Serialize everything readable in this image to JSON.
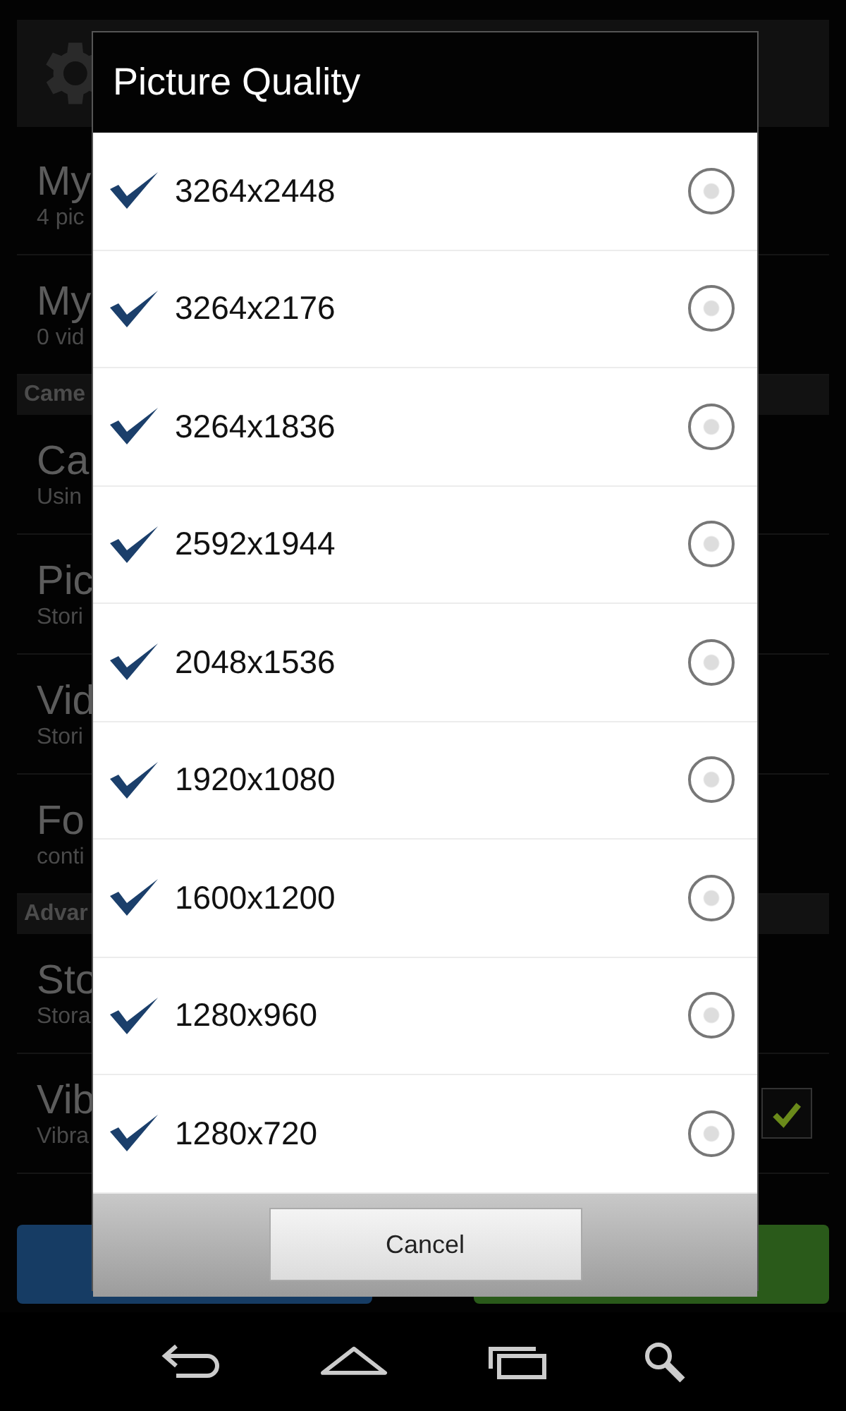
{
  "settings": {
    "items": [
      {
        "kind": "item",
        "title": "My",
        "subtitle": "4 pic"
      },
      {
        "kind": "item",
        "title": "My",
        "subtitle": "0 vid"
      },
      {
        "kind": "header",
        "title": "Came"
      },
      {
        "kind": "item",
        "title": "Ca",
        "subtitle": "Usin"
      },
      {
        "kind": "item",
        "title": "Pic",
        "subtitle": "Stori"
      },
      {
        "kind": "item",
        "title": "Vid",
        "subtitle": "Stori"
      },
      {
        "kind": "item",
        "title": "Fo",
        "subtitle": "conti"
      },
      {
        "kind": "header",
        "title": "Advar"
      },
      {
        "kind": "item",
        "title": "Sto",
        "subtitle": "Stora"
      },
      {
        "kind": "toggle",
        "title": "Vib",
        "subtitle": "Vibra",
        "checked": true
      }
    ]
  },
  "dialog": {
    "title": "Picture Quality",
    "options": [
      {
        "label": "3264x2448",
        "checked": true,
        "selected": false
      },
      {
        "label": "3264x2176",
        "checked": true,
        "selected": false
      },
      {
        "label": "3264x1836",
        "checked": true,
        "selected": false
      },
      {
        "label": "2592x1944",
        "checked": true,
        "selected": false
      },
      {
        "label": "2048x1536",
        "checked": true,
        "selected": false
      },
      {
        "label": "1920x1080",
        "checked": true,
        "selected": false
      },
      {
        "label": "1600x1200",
        "checked": true,
        "selected": false
      },
      {
        "label": "1280x960",
        "checked": true,
        "selected": false
      },
      {
        "label": "1280x720",
        "checked": true,
        "selected": false
      }
    ],
    "cancel": "Cancel"
  }
}
